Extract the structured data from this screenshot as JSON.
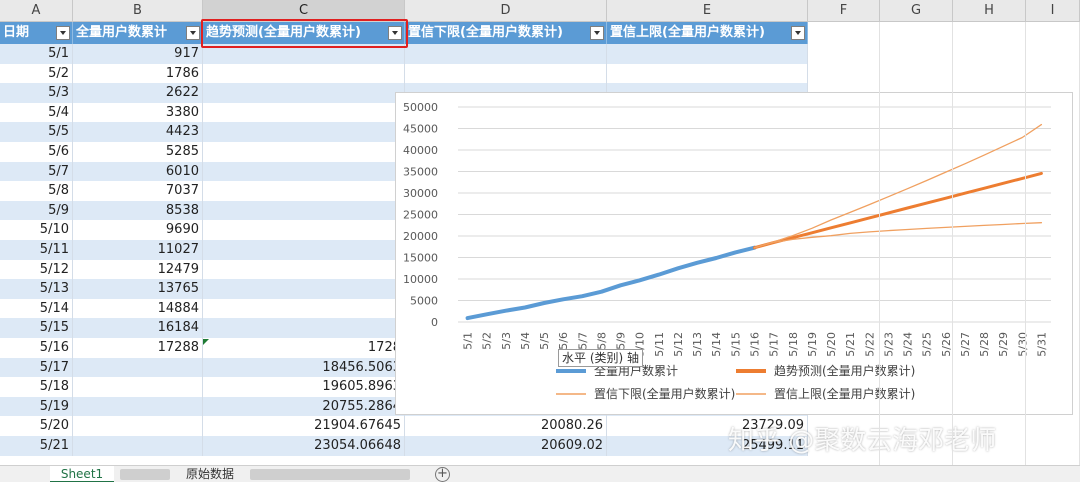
{
  "columns": [
    "A",
    "B",
    "C",
    "D",
    "E",
    "F",
    "G",
    "H",
    "I"
  ],
  "selected_column": "C",
  "table": {
    "headers": [
      "日期",
      "全量用户数累计",
      "趋势预测(全量用户数累计)",
      "置信下限(全量用户数累计)",
      "置信上限(全量用户数累计)"
    ],
    "rows": [
      [
        "5/1",
        "917",
        "",
        "",
        ""
      ],
      [
        "5/2",
        "1786",
        "",
        "",
        ""
      ],
      [
        "5/3",
        "2622",
        "",
        "",
        ""
      ],
      [
        "5/4",
        "3380",
        "",
        "",
        ""
      ],
      [
        "5/5",
        "4423",
        "",
        "",
        ""
      ],
      [
        "5/6",
        "5285",
        "",
        "",
        ""
      ],
      [
        "5/7",
        "6010",
        "",
        "",
        ""
      ],
      [
        "5/8",
        "7037",
        "",
        "",
        ""
      ],
      [
        "5/9",
        "8538",
        "",
        "",
        ""
      ],
      [
        "5/10",
        "9690",
        "",
        "",
        ""
      ],
      [
        "5/11",
        "11027",
        "",
        "",
        ""
      ],
      [
        "5/12",
        "12479",
        "",
        "",
        ""
      ],
      [
        "5/13",
        "13765",
        "",
        "",
        ""
      ],
      [
        "5/14",
        "14884",
        "",
        "",
        ""
      ],
      [
        "5/15",
        "16184",
        "",
        "",
        ""
      ],
      [
        "5/16",
        "17288",
        "1728",
        "",
        ""
      ],
      [
        "5/17",
        "",
        "18456.5063",
        "",
        ""
      ],
      [
        "5/18",
        "",
        "19605.8963",
        "",
        ""
      ],
      [
        "5/19",
        "",
        "20755.2864",
        "",
        ""
      ],
      [
        "5/20",
        "",
        "21904.67645",
        "20080.26",
        "23729.09"
      ],
      [
        "5/21",
        "",
        "23054.06648",
        "20609.02",
        "25499.11"
      ]
    ]
  },
  "chart_data": {
    "type": "line",
    "categories": [
      "5/1",
      "5/2",
      "5/3",
      "5/4",
      "5/5",
      "5/6",
      "5/7",
      "5/8",
      "5/9",
      "5/10",
      "5/11",
      "5/12",
      "5/13",
      "5/14",
      "5/15",
      "5/16",
      "5/17",
      "5/18",
      "5/19",
      "5/20",
      "5/21",
      "5/22",
      "5/23",
      "5/24",
      "5/25",
      "5/26",
      "5/27",
      "5/28",
      "5/29",
      "5/30",
      "5/31"
    ],
    "ylim": [
      0,
      50000
    ],
    "yticks": [
      "0",
      "5000",
      "10000",
      "15000",
      "20000",
      "25000",
      "30000",
      "35000",
      "40000",
      "45000",
      "50000"
    ],
    "grid": true,
    "legend_position": "bottom",
    "series": [
      {
        "name": "全量用户数累计",
        "color": "#5b9bd5",
        "values": [
          917,
          1786,
          2622,
          3380,
          4423,
          5285,
          6010,
          7037,
          8538,
          9690,
          11027,
          12479,
          13765,
          14884,
          16184,
          17288,
          null,
          null,
          null,
          null,
          null,
          null,
          null,
          null,
          null,
          null,
          null,
          null,
          null,
          null,
          null
        ]
      },
      {
        "name": "趋势预测(全量用户数累计)",
        "color": "#ed7d31",
        "values": [
          null,
          null,
          null,
          null,
          null,
          null,
          null,
          null,
          null,
          null,
          null,
          null,
          null,
          null,
          null,
          17288,
          18456.5,
          19605.9,
          20755.3,
          21904.7,
          23054.1,
          24203,
          25352,
          26502,
          27651,
          28800,
          29950,
          31099,
          32249,
          33398,
          34548
        ]
      },
      {
        "name": "置信下限(全量用户数累计)",
        "color": "#f0a060",
        "values": [
          null,
          null,
          null,
          null,
          null,
          null,
          null,
          null,
          null,
          null,
          null,
          null,
          null,
          null,
          null,
          17288,
          18500,
          19200,
          19700,
          20080.26,
          20609.02,
          20950,
          21250,
          21520,
          21760,
          22000,
          22230,
          22460,
          22680,
          22900,
          23100
        ]
      },
      {
        "name": "置信上限(全量用户数累计)",
        "color": "#f0a060",
        "values": [
          null,
          null,
          null,
          null,
          null,
          null,
          null,
          null,
          null,
          null,
          null,
          null,
          null,
          null,
          null,
          17288,
          18600,
          20100,
          21800,
          23729.09,
          25499.11,
          27300,
          29150,
          31000,
          32900,
          34850,
          36800,
          38800,
          40850,
          42900,
          45900
        ]
      }
    ]
  },
  "tooltip": "水平 (类别) 轴",
  "sheets": {
    "active": "Sheet1",
    "other": "原始数据"
  },
  "add_sheet_label": "+",
  "watermark": "知乎 @聚数云海邓老师"
}
